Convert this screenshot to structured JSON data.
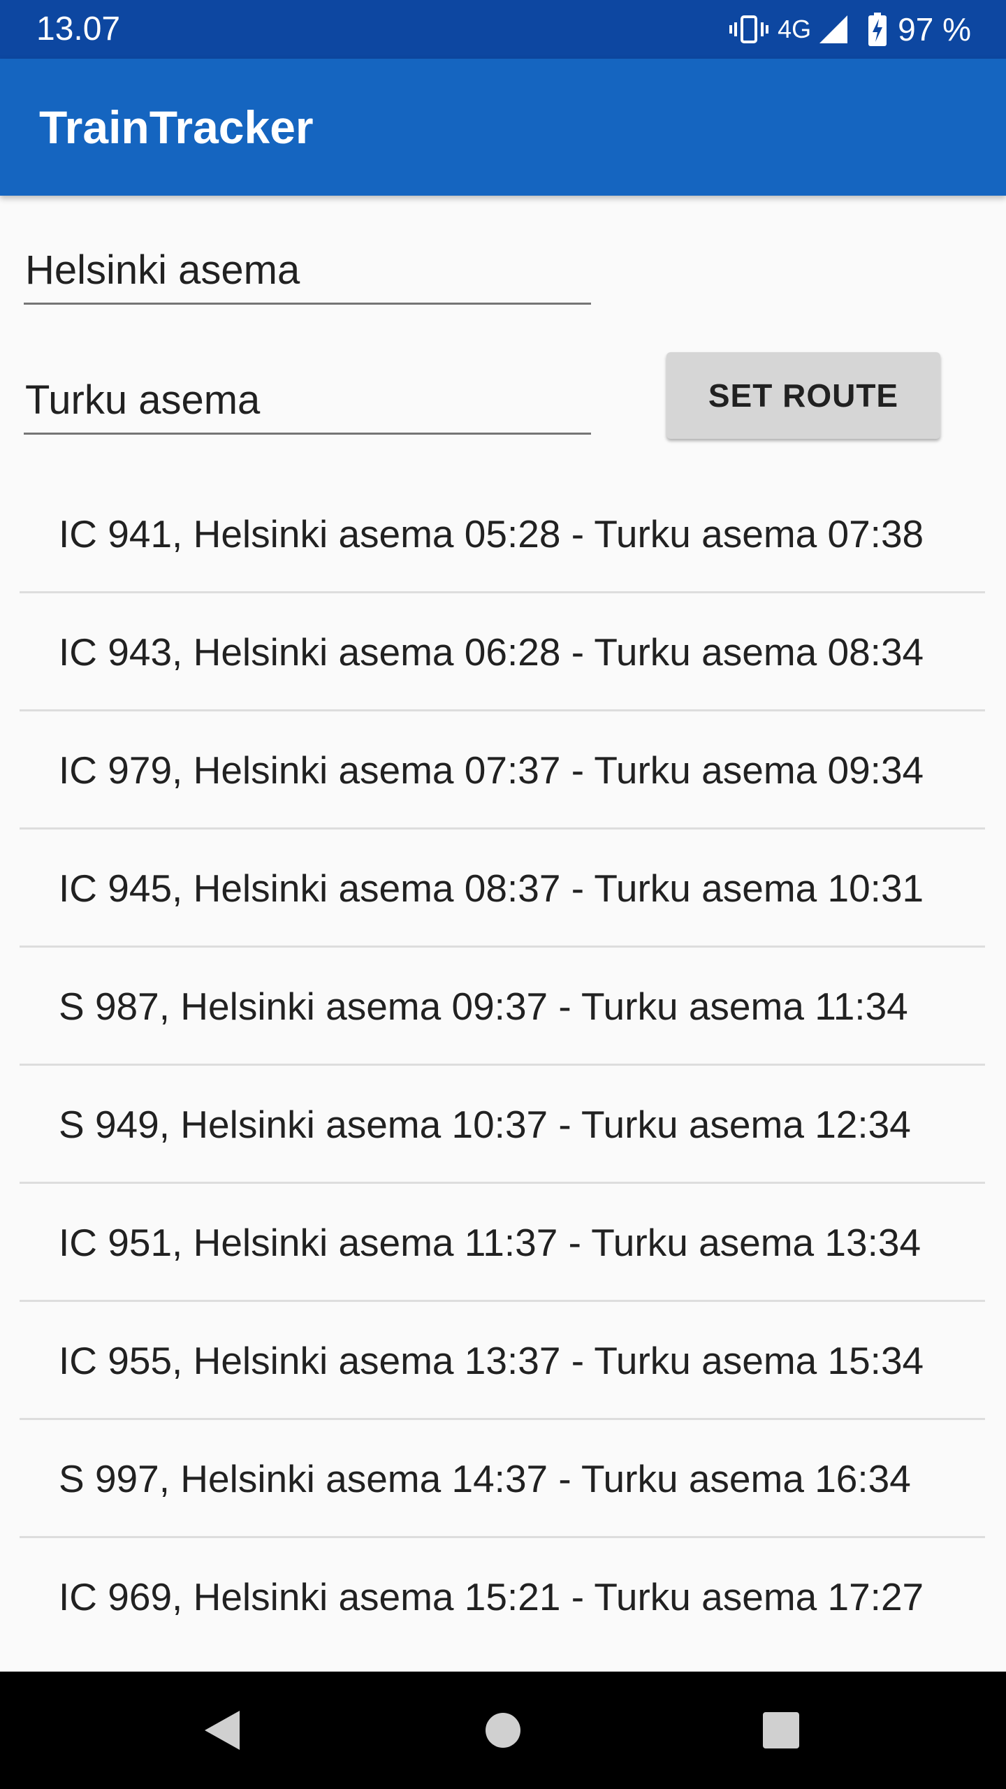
{
  "status_bar": {
    "time": "13.07",
    "network": "4G",
    "battery": "97 %",
    "icons": [
      "vibrate-icon",
      "signal-icon",
      "battery-charging-icon"
    ]
  },
  "app_bar": {
    "title": "TrainTracker",
    "color": "#1565c0"
  },
  "form": {
    "origin_value": "Helsinki asema",
    "destination_value": "Turku asema",
    "set_route_label": "SET ROUTE"
  },
  "routes": [
    "IC 941, Helsinki asema 05:28 - Turku asema 07:38",
    "IC 943, Helsinki asema 06:28 - Turku asema 08:34",
    "IC 979, Helsinki asema 07:37 - Turku asema 09:34",
    "IC 945, Helsinki asema 08:37 - Turku asema 10:31",
    "S 987, Helsinki asema 09:37 - Turku asema 11:34",
    "S 949, Helsinki asema 10:37 - Turku asema 12:34",
    "IC 951, Helsinki asema 11:37 - Turku asema 13:34",
    "IC 955, Helsinki asema 13:37 - Turku asema 15:34",
    "S 997, Helsinki asema 14:37 - Turku asema 16:34",
    "IC 969, Helsinki asema 15:21 - Turku asema 17:27"
  ],
  "nav_bar": {
    "icons": [
      "back-icon",
      "home-icon",
      "recents-icon"
    ]
  }
}
